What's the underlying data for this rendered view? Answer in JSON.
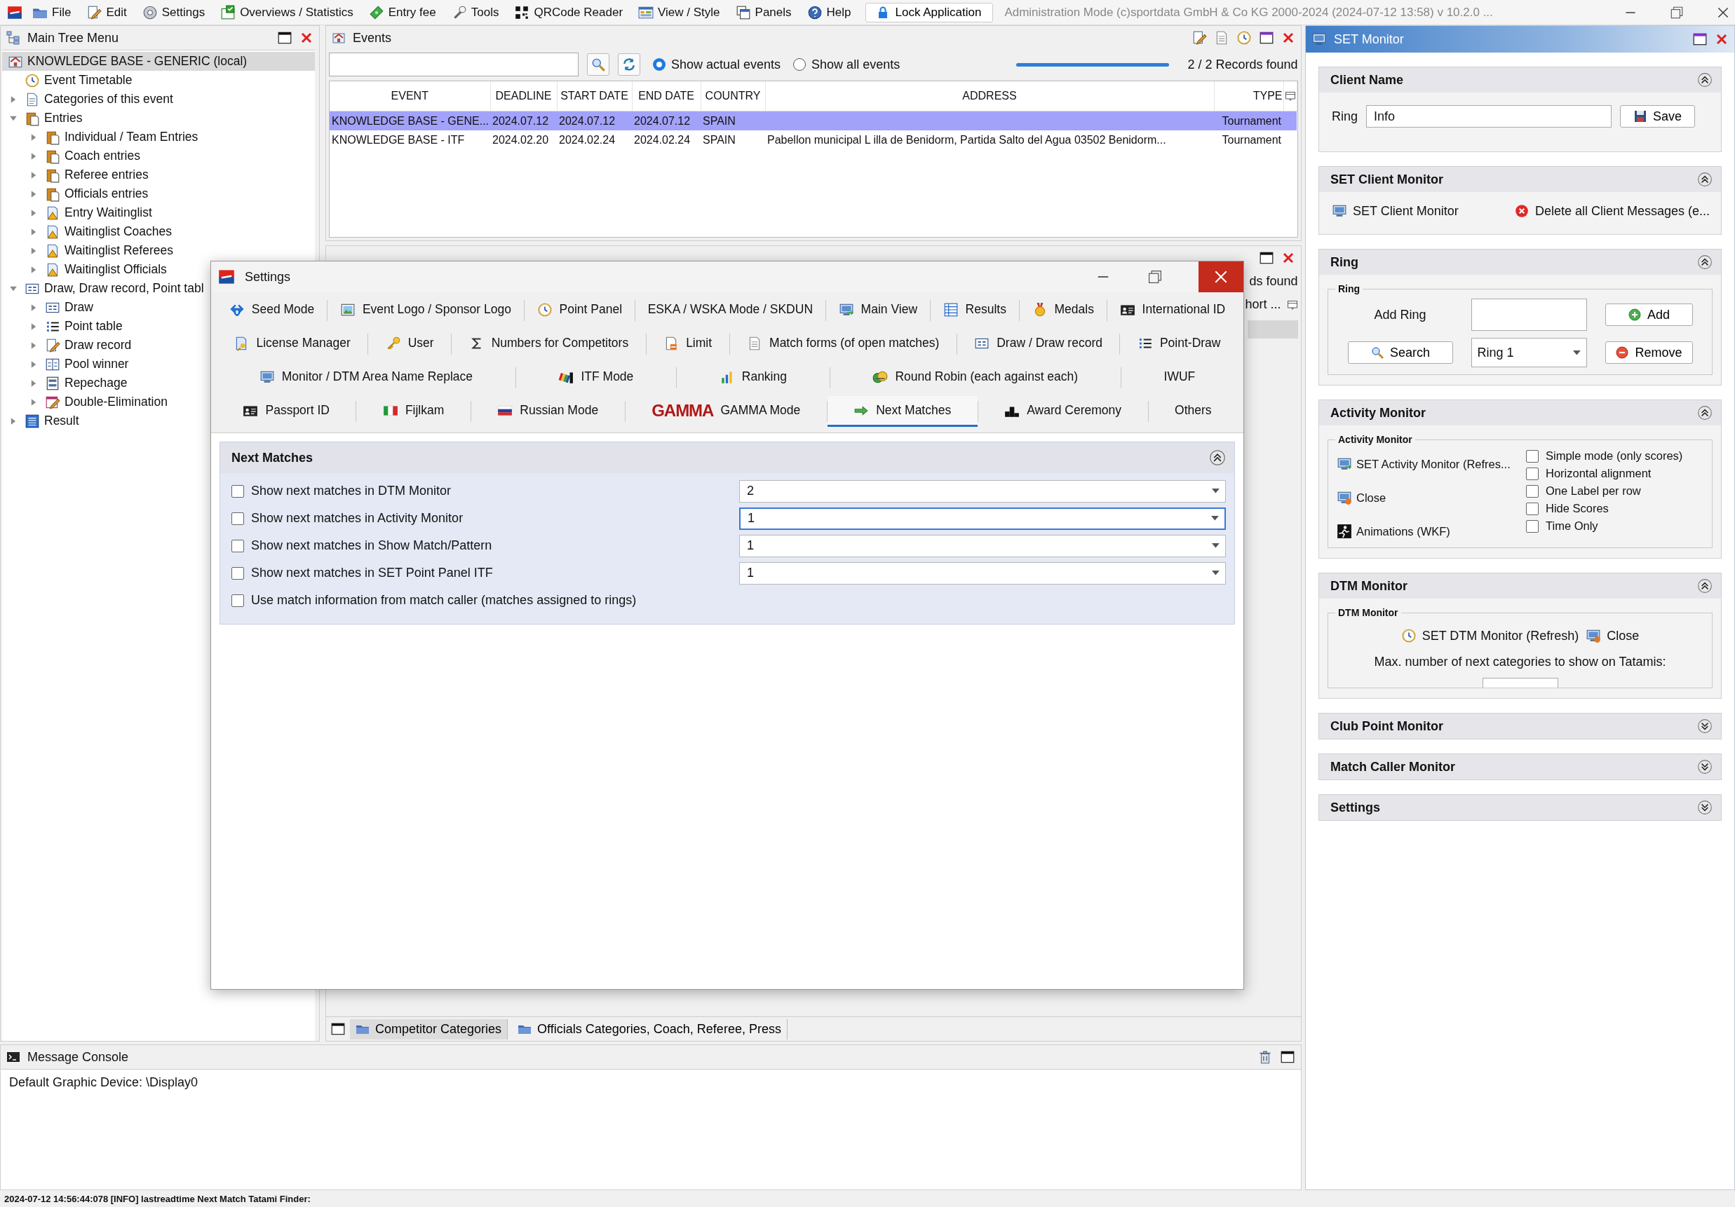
{
  "menu_bar": {
    "items": [
      "File",
      "Edit",
      "Settings",
      "Overviews / Statistics",
      "Entry fee",
      "Tools",
      "QRCode Reader",
      "View / Style",
      "Panels",
      "Help"
    ],
    "lock_button": "Lock Application",
    "title": "Administration Mode (c)sportdata GmbH & Co KG 2000-2024 (2024-07-12 13:58)  v 10.2.0 ..."
  },
  "tree_panel": {
    "title": "Main Tree Menu",
    "root": {
      "label": "KNOWLEDGE BASE - GENERIC (local)",
      "selected": true,
      "children": [
        {
          "label": "Event Timetable",
          "selected": false
        },
        {
          "label": "Categories of this event",
          "selected": false,
          "expanded": false
        },
        {
          "label": "Entries",
          "selected": false,
          "expanded": true,
          "children": [
            {
              "label": "Individual / Team Entries",
              "selected": false,
              "expanded": false
            },
            {
              "label": "Coach entries",
              "selected": false,
              "expanded": false
            },
            {
              "label": "Referee entries",
              "selected": false,
              "expanded": false
            },
            {
              "label": "Officials entries",
              "selected": false,
              "expanded": false
            },
            {
              "label": "Entry Waitinglist",
              "selected": false,
              "expanded": false
            },
            {
              "label": "Waitinglist Coaches",
              "selected": false,
              "expanded": false
            },
            {
              "label": "Waitinglist Referees",
              "selected": false,
              "expanded": false
            },
            {
              "label": "Waitinglist Officials",
              "selected": false,
              "expanded": false
            }
          ]
        },
        {
          "label": "Draw, Draw record, Point tabl",
          "selected": false,
          "expanded": true,
          "children": [
            {
              "label": "Draw",
              "selected": false,
              "expanded": false
            },
            {
              "label": "Point table",
              "selected": false,
              "expanded": false
            },
            {
              "label": "Draw record",
              "selected": false,
              "expanded": false
            },
            {
              "label": "Pool winner",
              "selected": false,
              "expanded": false
            },
            {
              "label": "Repechage",
              "selected": false,
              "expanded": false
            },
            {
              "label": "Double-Elimination",
              "selected": false,
              "expanded": false
            }
          ]
        },
        {
          "label": "Result",
          "selected": false,
          "expanded": false
        }
      ]
    }
  },
  "events_panel": {
    "title": "Events",
    "filters": [
      {
        "label": "Show actual events",
        "selected": true
      },
      {
        "label": "Show all events",
        "selected": false
      }
    ],
    "progress": {
      "level": 1
    },
    "records": "2 / 2 Records found",
    "table": {
      "columns": [
        "EVENT",
        "DEADLINE",
        "START DATE",
        "END DATE",
        "COUNTRY",
        "ADDRESS",
        "TYPE"
      ],
      "rows": [
        {
          "selected": true,
          "cells": [
            "KNOWLEDGE BASE - GENE...",
            "2024.07.12",
            "2024.07.12",
            "2024.07.12",
            "SPAIN",
            null,
            "Tournament"
          ]
        },
        {
          "selected": false,
          "cells": [
            "KNOWLEDGE BASE - ITF",
            "2024.02.20",
            "2024.02.24",
            "2024.02.24",
            "SPAIN",
            "Pabellon municipal L illa de Benidorm, Partida Salto del Agua 03502 Benidorm...",
            "Tournament"
          ]
        }
      ]
    }
  },
  "categories_panel": {
    "fragments": [
      "ds found",
      "hort ..."
    ],
    "tabs": [
      {
        "label": "Competitor Categories",
        "selected": true
      },
      {
        "label": "Officials Categories, Coach, Referee, Press",
        "selected": false
      }
    ]
  },
  "console": {
    "title": "Message Console",
    "lines": [
      "Default Graphic Device: \\Display0"
    ]
  },
  "status_bar": "2024-07-12 14:56:44:078 [INFO] lastreadtime Next Match Tatami Finder:",
  "settings_dialog": {
    "title": "Settings",
    "tab_rows": [
      [
        {
          "label": "Seed Mode",
          "selected": false
        },
        {
          "label": "Event Logo / Sponsor Logo",
          "selected": false
        },
        {
          "label": "Point Panel",
          "selected": false
        },
        {
          "label": "ESKA / WSKA Mode / SKDUN",
          "selected": false
        },
        {
          "label": "Main View",
          "selected": false
        },
        {
          "label": "Results",
          "selected": false
        },
        {
          "label": "Medals",
          "selected": false
        },
        {
          "label": "International ID",
          "selected": false
        }
      ],
      [
        {
          "label": "License Manager",
          "selected": false
        },
        {
          "label": "User",
          "selected": false
        },
        {
          "label": "Numbers for Competitors",
          "selected": false
        },
        {
          "label": "Limit",
          "selected": false
        },
        {
          "label": "Match forms (of open matches)",
          "selected": false
        },
        {
          "label": "Draw / Draw record",
          "selected": false
        },
        {
          "label": "Point-Draw",
          "selected": false
        }
      ],
      [
        {
          "label": "Monitor / DTM Area Name Replace",
          "selected": false
        },
        {
          "label": "ITF Mode",
          "selected": false
        },
        {
          "label": "Ranking",
          "selected": false
        },
        {
          "label": "Round Robin (each against each)",
          "selected": false
        },
        {
          "label": "IWUF",
          "selected": false
        }
      ],
      [
        {
          "label": "Passport ID",
          "selected": false
        },
        {
          "label": "Fijlkam",
          "selected": false
        },
        {
          "label": "Russian Mode",
          "selected": false
        },
        {
          "label": "GAMMA Mode",
          "logo_text": "GAMMA",
          "selected": false
        },
        {
          "label": "Next Matches",
          "selected": true
        },
        {
          "label": "Award Ceremony",
          "selected": false
        },
        {
          "label": "Others",
          "selected": false
        }
      ]
    ],
    "section": {
      "title": "Next Matches",
      "expanded": true,
      "rows": [
        {
          "kind": "dropdown",
          "label": "Show next matches in DTM Monitor",
          "checked": false,
          "value": "2",
          "focused": false
        },
        {
          "kind": "dropdown",
          "label": "Show next matches in Activity Monitor",
          "checked": false,
          "value": "1",
          "focused": true
        },
        {
          "kind": "dropdown",
          "label": "Show next matches in Show Match/Pattern",
          "checked": false,
          "value": "1",
          "focused": false
        },
        {
          "kind": "dropdown",
          "label": "Show next matches in SET Point Panel ITF",
          "checked": false,
          "value": "1",
          "focused": false
        },
        {
          "kind": "plain",
          "label": "Use match information from match caller (matches assigned to rings)",
          "checked": false
        }
      ]
    }
  },
  "set_monitor": {
    "title": "SET Monitor",
    "sections": [
      {
        "kind": "client_name",
        "title": "Client Name",
        "expanded": true,
        "label": "Ring",
        "value": "Info",
        "button": "Save"
      },
      {
        "kind": "client_monitor",
        "title": "SET Client Monitor",
        "expanded": true,
        "monitor_button": "SET Client Monitor",
        "delete_button": "Delete all Client Messages (e..."
      },
      {
        "kind": "ring",
        "title": "Ring",
        "expanded": true,
        "group": "Ring",
        "add_label": "Add Ring",
        "add_button": "Add",
        "search_button": "Search",
        "ring_select": "Ring 1",
        "remove_button": "Remove"
      },
      {
        "kind": "activity",
        "title": "Activity Monitor",
        "expanded": true,
        "group": "Activity Monitor",
        "actions": [
          "SET Activity Monitor (Refres...",
          "Close",
          "Animations (WKF)"
        ],
        "options": [
          {
            "label": "Simple mode (only scores)",
            "checked": false
          },
          {
            "label": "Horizontal alignment",
            "checked": false
          },
          {
            "label": "One Label per row",
            "checked": false
          },
          {
            "label": "Hide Scores",
            "checked": false
          },
          {
            "label": "Time Only",
            "checked": false
          }
        ]
      },
      {
        "kind": "dtm",
        "title": "DTM Monitor",
        "expanded": true,
        "group": "DTM Monitor",
        "refresh_button": "SET DTM Monitor (Refresh)",
        "close_button": "Close",
        "max_label": "Max. number of next categories to show on Tatamis:"
      },
      {
        "title": "Club Point Monitor",
        "expanded": false
      },
      {
        "title": "Match Caller Monitor",
        "expanded": false
      },
      {
        "title": "Settings",
        "expanded": false
      }
    ]
  }
}
